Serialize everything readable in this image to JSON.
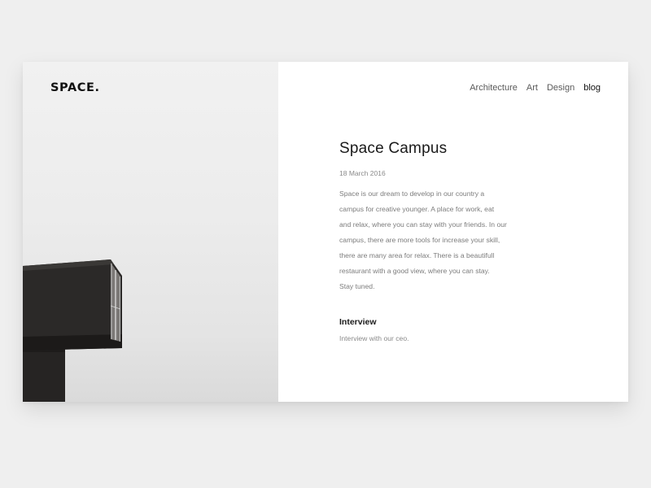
{
  "brand": {
    "logo": "SPACE."
  },
  "nav": {
    "items": [
      "Architecture",
      "Art",
      "Design",
      "blog"
    ],
    "active": "blog"
  },
  "article": {
    "title": "Space Campus",
    "date": "18 March 2016",
    "body_lines": [
      "Space is our dream to develop in our country a",
      "campus for creative younger.  A place for work,  eat",
      "and relax, where you can stay with your friends. In our",
      "campus, there are more tools for increase your skill,",
      "there are many area for relax.  There is a beautifull",
      "restaurant with a good view, where you can stay.",
      "Stay tuned."
    ],
    "subheading": "Interview",
    "subtext": "Interview with our ceo."
  },
  "colors": {
    "page_background": "#efefef",
    "card_background": "#ffffff",
    "text_dark": "#1a1a1a",
    "text_muted": "#7c7c7c",
    "building": "#2b2928"
  }
}
